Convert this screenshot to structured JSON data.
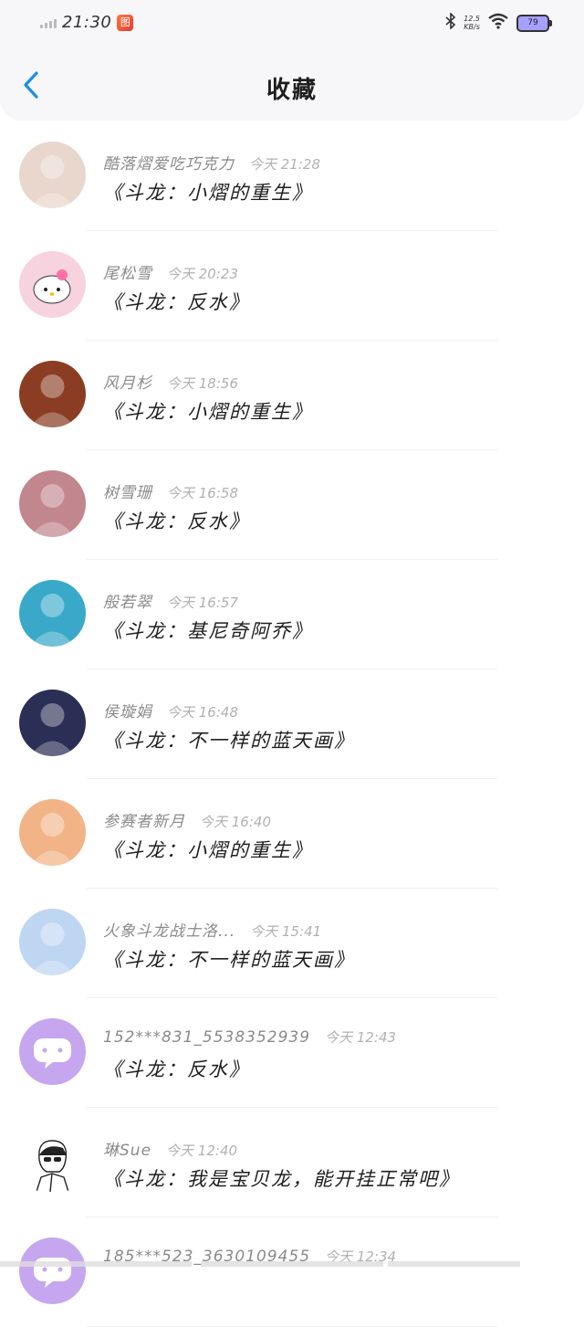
{
  "status_bar": {
    "time": "21:30",
    "app_badge": "图",
    "net_speed_value": "12.5",
    "net_speed_unit": "KB/s",
    "battery": "79"
  },
  "header": {
    "title": "收藏"
  },
  "favorites": [
    {
      "author": "酷落熠爱吃巧克力",
      "time": "今天 21:28",
      "title": "《斗龙：小熠的重生》",
      "avatar_icon": "cartoon-girl-avatar",
      "avatar_color": "#e9d6cc"
    },
    {
      "author": "尾松雪",
      "time": "今天 20:23",
      "title": "《斗龙：反水》",
      "avatar_icon": "hello-kitty-avatar",
      "avatar_color": "#f7d3df"
    },
    {
      "author": "风月杉",
      "time": "今天 18:56",
      "title": "《斗龙：小熠的重生》",
      "avatar_icon": "pens-photo-avatar",
      "avatar_color": "#8a3d22"
    },
    {
      "author": "树雪珊",
      "time": "今天 16:58",
      "title": "《斗龙：反水》",
      "avatar_icon": "portrait-photo-avatar",
      "avatar_color": "#c2868f"
    },
    {
      "author": "般若翠",
      "time": "今天 16:57",
      "title": "《斗龙：基尼奇阿乔》",
      "avatar_icon": "dancer-photo-avatar",
      "avatar_color": "#3aa9c9"
    },
    {
      "author": "侯璇娟",
      "time": "今天 16:48",
      "title": "《斗龙：不一样的蓝天画》",
      "avatar_icon": "girl-photo-avatar",
      "avatar_color": "#2c2f55"
    },
    {
      "author": "参赛者新月",
      "time": "今天 16:40",
      "title": "《斗龙：小熠的重生》",
      "avatar_icon": "anime-girl-avatar",
      "avatar_color": "#f2b487"
    },
    {
      "author": "火象斗龙战士洛...",
      "time": "今天 15:41",
      "title": "《斗龙：不一样的蓝天画》",
      "avatar_icon": "anime-sky-avatar",
      "avatar_color": "#bfd6f2"
    },
    {
      "author": "152***831_5538352939",
      "time": "今天 12:43",
      "title": "《斗龙：反水》",
      "avatar_icon": "chat-bubble-avatar",
      "avatar_color": "#c7a6f0"
    },
    {
      "author": "琳Sue",
      "time": "今天 12:40",
      "title": "《斗龙：我是宝贝龙，能开挂正常吧》",
      "avatar_icon": "sketch-boy-avatar",
      "avatar_color": "#ffffff"
    },
    {
      "author": "185***523_3630109455",
      "time": "今天 12:34",
      "title": "",
      "avatar_icon": "chat-bubble-avatar",
      "avatar_color": "#c7a6f0"
    }
  ]
}
